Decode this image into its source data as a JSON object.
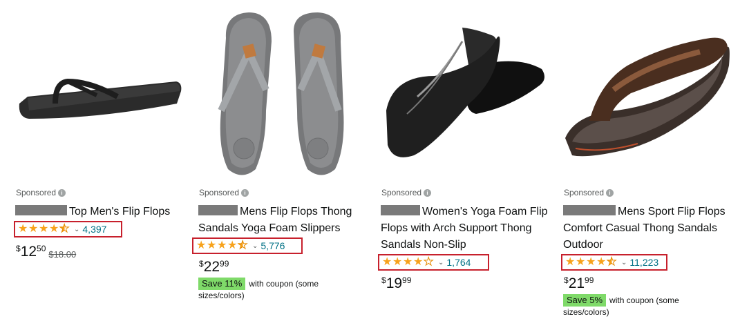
{
  "products": [
    {
      "sponsored": "Sponsored",
      "title": "Top Men's Flip Flops",
      "rating_stars": 4.5,
      "rating_count": "4,397",
      "price_symbol": "$",
      "price_whole": "12",
      "price_fraction": "50",
      "price_was": "$18.00"
    },
    {
      "sponsored": "Sponsored",
      "title": "Mens Flip Flops Thong Sandals Yoga Foam Slippers",
      "rating_stars": 4.5,
      "rating_count": "5,776",
      "price_symbol": "$",
      "price_whole": "22",
      "price_fraction": "99",
      "coupon_badge": "Save 11%",
      "coupon_text": "with coupon (some sizes/colors)"
    },
    {
      "sponsored": "Sponsored",
      "title": "Women's Yoga Foam Flip Flops with Arch Support Thong Sandals Non-Slip",
      "rating_stars": 4.0,
      "rating_count": "1,764",
      "price_symbol": "$",
      "price_whole": "19",
      "price_fraction": "99"
    },
    {
      "sponsored": "Sponsored",
      "title": "Mens Sport Flip Flops Comfort Casual Thong Sandals Outdoor",
      "rating_stars": 4.5,
      "rating_count": "11,223",
      "price_symbol": "$",
      "price_whole": "21",
      "price_fraction": "99",
      "coupon_badge": "Save 5%",
      "coupon_text": "with coupon (some sizes/colors)"
    }
  ],
  "colors": {
    "star": "#f7a21b",
    "link": "#007185",
    "highlight_box": "#c7202c",
    "coupon_badge": "#7fda69"
  },
  "icons": {
    "info": "info-circle-icon",
    "caret": "chevron-down-icon"
  }
}
